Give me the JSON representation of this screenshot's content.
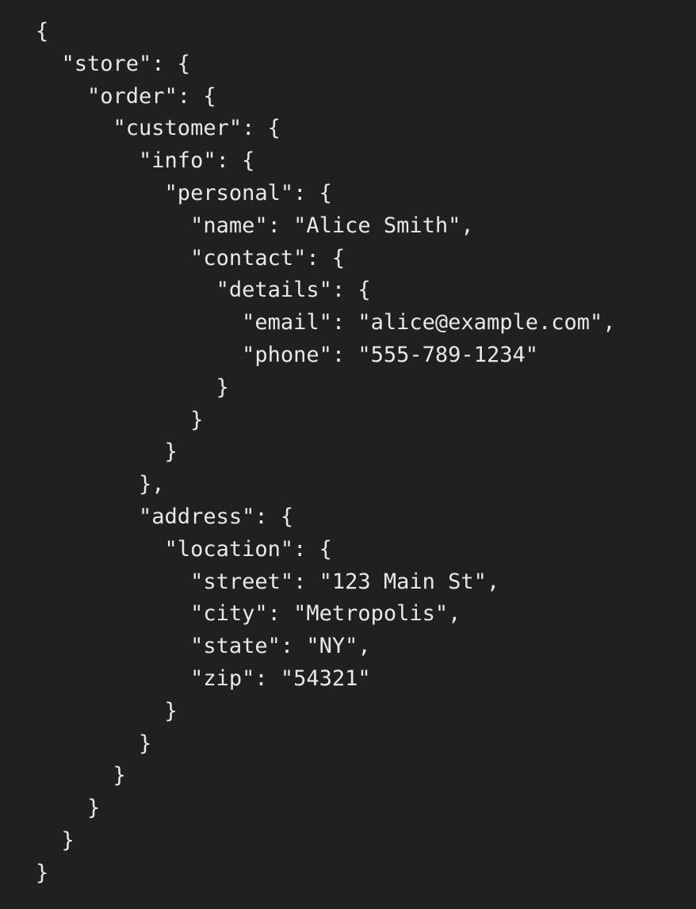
{
  "colors": {
    "background": "#202020",
    "text": "#e8e8e8"
  },
  "lines": [
    "{",
    "  \"store\": {",
    "    \"order\": {",
    "      \"customer\": {",
    "        \"info\": {",
    "          \"personal\": {",
    "            \"name\": \"Alice Smith\",",
    "            \"contact\": {",
    "              \"details\": {",
    "                \"email\": \"alice@example.com\",",
    "                \"phone\": \"555-789-1234\"",
    "              }",
    "            }",
    "          }",
    "        },",
    "        \"address\": {",
    "          \"location\": {",
    "            \"street\": \"123 Main St\",",
    "            \"city\": \"Metropolis\",",
    "            \"state\": \"NY\",",
    "            \"zip\": \"54321\"",
    "          }",
    "        }",
    "      }",
    "    }",
    "  }",
    "}"
  ]
}
